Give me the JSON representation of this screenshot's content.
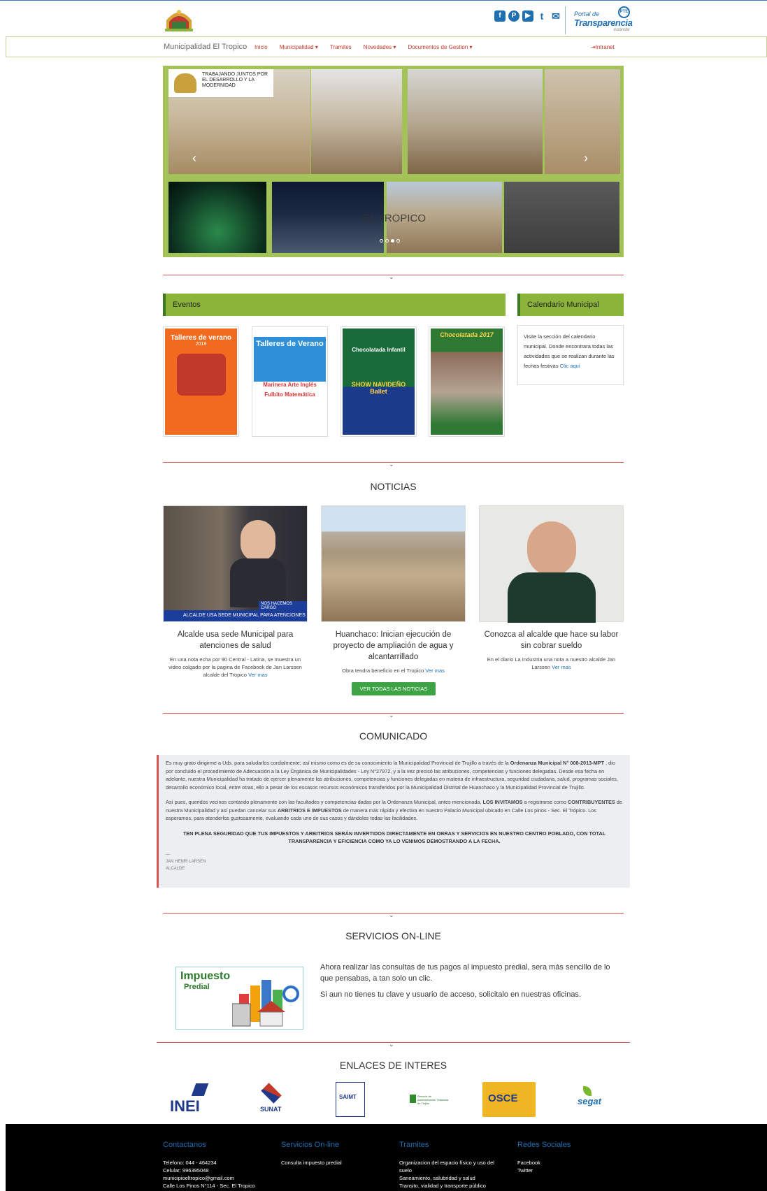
{
  "header": {
    "social_icons": [
      {
        "name": "facebook-icon",
        "glyph": "f"
      },
      {
        "name": "pinterest-icon",
        "glyph": "P"
      },
      {
        "name": "youtube-icon",
        "glyph": "▶"
      },
      {
        "name": "twitter-icon",
        "glyph": "t"
      },
      {
        "name": "mail-icon",
        "glyph": "✉"
      }
    ],
    "portal_line1": "Portal de",
    "portal_line2": "Transparencia",
    "portal_line3": "estándar",
    "portal_badge": "PTE"
  },
  "nav": {
    "brand": "Municipalidad El Tropico",
    "items": [
      "Inicio",
      "Municipalidad ▾",
      "Tramites",
      "Novedades ▾",
      "Documentos de Gestion ▾"
    ],
    "intranet": "⇥Intranet"
  },
  "slider": {
    "logo_text": "TRABAJANDO JUNTOS POR EL DESARROLLO Y LA MODERNIDAD",
    "caption": "EL TROPICO",
    "prev": "‹",
    "next": "›"
  },
  "chevron": "⌄",
  "eventos": {
    "title": "Eventos",
    "posters": [
      {
        "heading": "Talleres de verano",
        "sub": "2018",
        "color": "#f06a1f"
      },
      {
        "heading": "Talleres de Verano",
        "sub": "Marinera  Arte  Inglés  Fulbito  Matemática",
        "color": "#2f8fd9"
      },
      {
        "heading": "Chocolatada Infantil",
        "sub": "SHOW NAVIDEÑO  Ballet",
        "color": "#1a6b3a"
      },
      {
        "heading": "Chocolatada 2017",
        "sub": "",
        "color": "#2f7a33"
      }
    ]
  },
  "calendario": {
    "title": "Calendario Municipal",
    "text": "Visite la sección del calendario municipal. Donde encontrara todas las actividades que se realizan durante las fechas festivas",
    "link": "Clic aquí"
  },
  "noticias": {
    "title": "NOTICIAS",
    "items": [
      {
        "title": "Alcalde usa sede Municipal para atenciones de salud",
        "desc": "En una nota echa por 90 Central - Latina, se muestra un video colgado por la pagina de Facebook de Jan Larssen alcalde del Tropico",
        "more": "Ver mas",
        "overlay": "ALCALDE USA SEDE MUNICIPAL PARA ATENCIONES DE SALUD",
        "tag": "NOS HACEMOS CARGO"
      },
      {
        "title": "Huanchaco: Inician ejecución de proyecto de ampliación de agua y alcantarrillado",
        "desc": "Obra tendra beneficio en el Tropico",
        "more": "Ver mas"
      },
      {
        "title": "Conozca al alcalde que hace su labor sin cobrar sueldo",
        "desc": "En el diario La Industria una nota a nuestro alcalde Jan Larssen",
        "more": "Ver mas"
      }
    ],
    "button": "VER TODAS LAS NOTICIAS"
  },
  "comunicado": {
    "title": "COMUNICADO",
    "p1_a": "Es muy grato dirigirme a Uds. para saludarlos cordialmente; así mismo como es de su conocimiento la Municipalidad Provincial de Trujillo a través de la ",
    "p1_b": "Ordenanza Municipal N° 008-2013-MPT",
    "p1_c": " , dio por concluido el procedimiento de Adecuación a la Ley Orgánica de Municipalidades - Ley N°27972, y a la vez precisó las atribuciones, competencias y funciones delegadas. Desde esa fecha en adelante, nuestra Municipalidad ha tratado de ejercer plenamente las atribuciones, competencias y funciones delegadas en materia de infraestructura, seguridad ciudadana, salud, programas sociales, desarrollo económico local, entre otras, ello a pesar de los escasos recursos económicos transferidos por la Municipalidad Distrital de Huanchaco y la Municipalidad Provincial de Trujillo.",
    "p2_a": "Así pues, queridos vecinos contando plenamente con las facultades y competencias dadas por la Ordenanza Municipal, antes mencionada, ",
    "p2_b": "LOS INVITAMOS",
    "p2_c": " a registrarse como ",
    "p2_d": "CONTRIBUYENTES",
    "p2_e": " de nuestra Municipalidad y así puedan cancelar sus ",
    "p2_f": "ARBITRIOS E IMPUESTOS",
    "p2_g": " de manera más rápida y efectiva en nuestro Palacio Municipal ubicado en Calle Los pinos - Sec. El Trópico. Los esperamos, para atenderlos gustosamente, evaluando cada uno de sus casos y dándoles todas las facilidades.",
    "center": "TEN PLENA SEGURIDAD QUE TUS IMPUESTOS Y ARBITRIOS SERÁN INVERTIDOS DIRECTAMENTE EN OBRAS Y SERVICIOS EN NUESTRO CENTRO POBLADO, CON TOTAL TRANSPARENCIA Y EFICIENCIA COMO YA LO VENIMOS DEMOSTRANDO A LA FECHA.",
    "dash": "—",
    "signer": "JAN HENRI LARSEN",
    "role": "ALCALDE"
  },
  "servicios": {
    "title": "SERVICIOS ON-LINE",
    "img_title": "Impuesto",
    "img_sub": "Predial",
    "p1": "Ahora realizar las consultas de tus pagos al impuesto predial, sera más sencillo de lo que pensabas, a tan solo un clic.",
    "p2": "Si aun no tienes tu clave y usuario de acceso, solicitalo en nuestras oficinas."
  },
  "enlaces": {
    "title": "ENLACES DE INTERES",
    "items": [
      "INEI",
      "SUNAT",
      "SAIMT",
      "Servicio de Administración Tributaria de Trujillo",
      "OSCE",
      "segat"
    ]
  },
  "footer": {
    "contact_title": "Contactanos",
    "contact_lines": [
      "Telefono: 044 - 464234",
      "Celular: 996395048",
      "municipioeltropico@gmail.com",
      "Calle Los Pinos N°114 - Sec. El Tropico"
    ],
    "services_title": "Servicios On-line",
    "services_lines": [
      "Consulta impuesto predial"
    ],
    "tramites_title": "Tramites",
    "tramites_lines": [
      "Organizacion del espacio físico y uso del suelo",
      "Saneamiento, salubridad y salud",
      "Transito, vialidad y transporte público"
    ],
    "redes_title": "Redes Sociales",
    "redes_lines": [
      "Facebook",
      "Twitter"
    ]
  }
}
